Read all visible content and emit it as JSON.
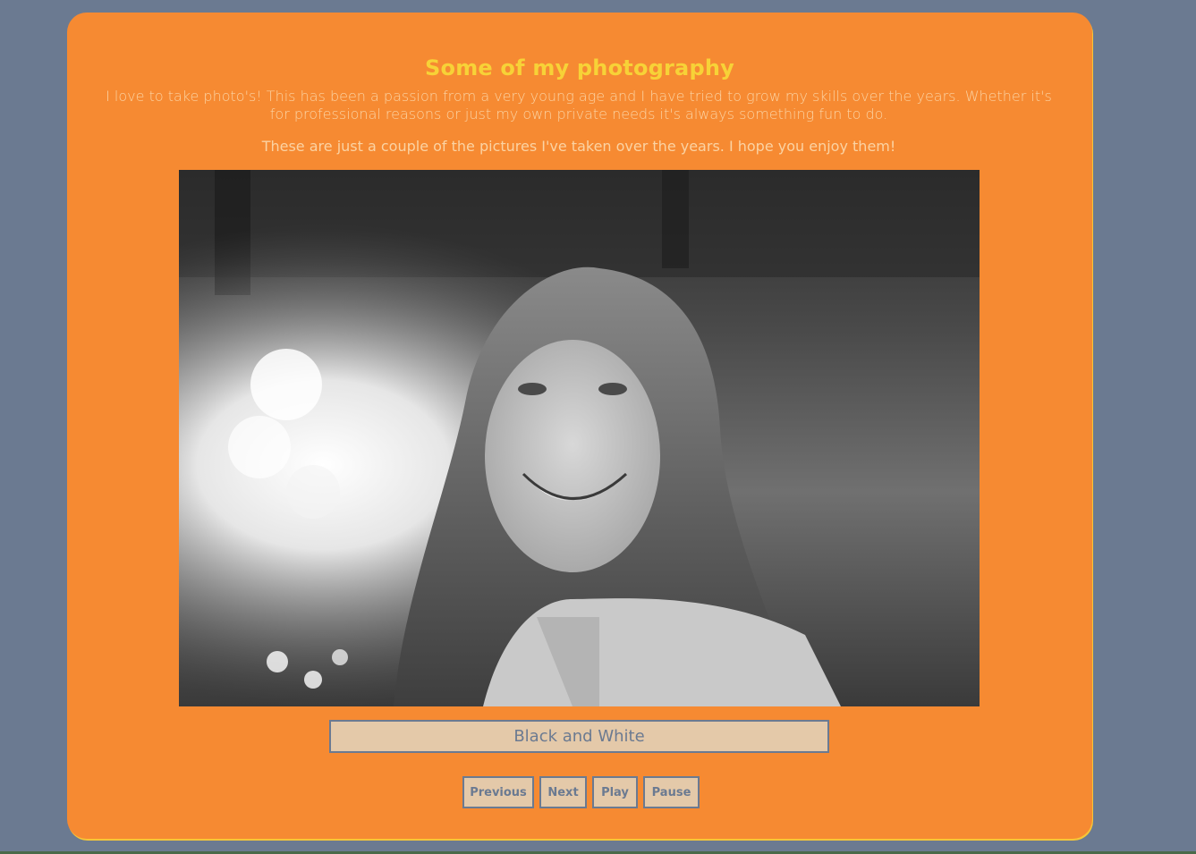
{
  "page": {
    "title": "Some of my photography",
    "intro": "I love to take photo's! This has been a passion from a very young age and I have tried to grow my skills over the years. Whether it's for professional reasons or just my own private needs it's always something fun to do.",
    "subtitle": "These are just a couple of the pictures I've taken over the years. I hope you enjoy them!"
  },
  "slideshow": {
    "caption": "Black and White",
    "buttons": {
      "previous": "Previous",
      "next": "Next",
      "play": "Play",
      "pause": "Pause"
    }
  },
  "colors": {
    "background": "#6b7a91",
    "card": "#f68a32",
    "title": "#f7d237",
    "text": "#fbd3a3",
    "button_bg": "#e4c9a9",
    "button_text": "#6b7a91"
  }
}
